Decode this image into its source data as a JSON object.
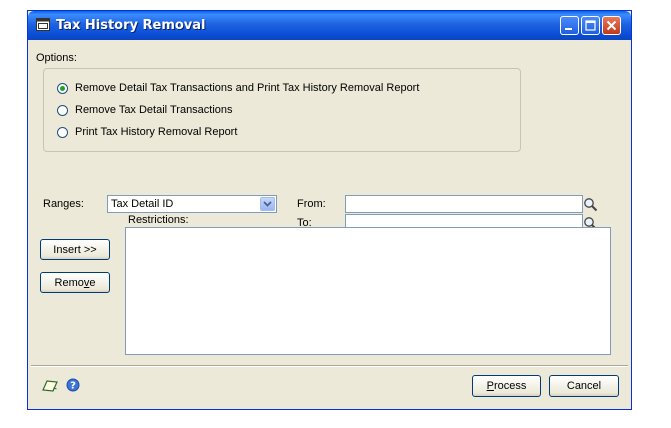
{
  "window": {
    "title": "Tax History Removal",
    "title_icon": "app-window-icon",
    "minimize_icon": "minimize-icon",
    "maximize_icon": "maximize-icon",
    "close_icon": "close-icon"
  },
  "options": {
    "label": "Options:",
    "radios": [
      {
        "label": "Remove Detail Tax Transactions and Print Tax History Removal Report",
        "checked": true
      },
      {
        "label": "Remove Tax Detail Transactions",
        "checked": false
      },
      {
        "label": "Print Tax History Removal Report",
        "checked": false
      }
    ]
  },
  "ranges": {
    "label": "Ranges:",
    "selected": "Tax Detail ID",
    "from_label": "From:",
    "from_value": "",
    "to_label": "To:",
    "to_value": ""
  },
  "restrictions": {
    "label": "Restrictions:",
    "items": []
  },
  "buttons": {
    "insert": "Insert >>",
    "remove_pre": "Remo",
    "remove_ul": "v",
    "remove_post": "e",
    "process_pre": "",
    "process_ul": "P",
    "process_post": "rocess",
    "cancel": "Cancel"
  },
  "colors": {
    "titlebar": "#0a4fd6",
    "window_bg": "#ece9d8",
    "radio_dot": "#21a121",
    "close_button": "#c2391b"
  }
}
